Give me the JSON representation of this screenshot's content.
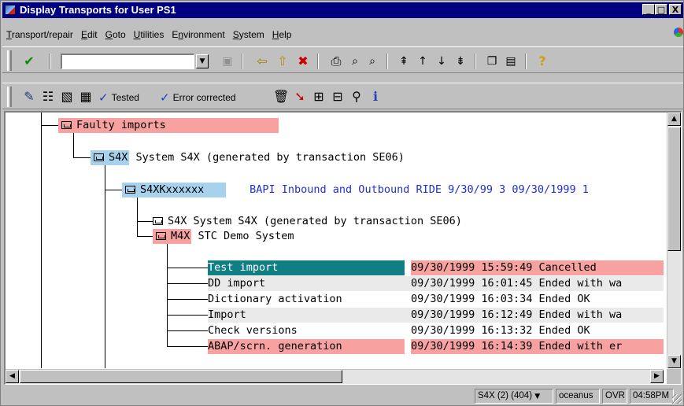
{
  "window": {
    "title": "Display Transports for User PS1",
    "minimize": "_",
    "restore": "□",
    "close": "X"
  },
  "menu": [
    {
      "pre": "",
      "u": "T",
      "post": "ransport/repair"
    },
    {
      "pre": "",
      "u": "E",
      "post": "dit"
    },
    {
      "pre": "",
      "u": "G",
      "post": "oto"
    },
    {
      "pre": "",
      "u": "U",
      "post": "tilities"
    },
    {
      "pre": "E",
      "u": "n",
      "post": "vironment"
    },
    {
      "pre": "",
      "u": "S",
      "post": "ystem"
    },
    {
      "pre": "",
      "u": "H",
      "post": "elp"
    }
  ],
  "toolbar1": {
    "command_value": "",
    "icons": [
      "checkmark-icon",
      "save-icon",
      "back-icon",
      "exit-icon",
      "cancel-icon",
      "print-icon",
      "find-icon",
      "find-next-icon",
      "first-page-icon",
      "previous-page-icon",
      "next-page-icon",
      "last-page-icon",
      "create-session-icon",
      "shortcut-icon",
      "help-icon"
    ]
  },
  "toolbar2": {
    "tested_label": "Tested",
    "error_corrected_label": "Error corrected"
  },
  "tree": {
    "faulty_imports": "Faulty imports",
    "system_node": {
      "key": "S4X",
      "text": "System S4X (generated by transaction SE06)"
    },
    "request_node": {
      "key": "S4XKxxxxxx",
      "desc": "BAPI Inbound and Outbound RIDE 9/30/99 3 09/30/1999 1"
    },
    "sub_system_node": {
      "key": "S4X",
      "text": "System S4X (generated by transaction SE06)"
    },
    "target_node": {
      "key": "M4X",
      "text": "STC Demo System"
    },
    "steps": [
      {
        "name": "Test import",
        "status": "09/30/1999 15:59:49 Cancelled"
      },
      {
        "name": "DD import",
        "status": "09/30/1999 16:01:45 Ended with wa"
      },
      {
        "name": "Dictionary activation",
        "status": "09/30/1999 16:03:34 Ended OK"
      },
      {
        "name": "Import",
        "status": "09/30/1999 16:12:49 Ended with wa"
      },
      {
        "name": "Check versions",
        "status": "09/30/1999 16:13:32 Ended OK"
      },
      {
        "name": "ABAP/scrn. generation",
        "status": "09/30/1999 16:14:39 Ended with er"
      }
    ]
  },
  "statusbar": {
    "session": "S4X (2) (404)",
    "session_arrow": "▼",
    "server": "oceanus",
    "mode": "OVR",
    "time": "04:58PM"
  },
  "colors": {
    "title_bg": "#000080",
    "error_highlight": "#f7a1a1",
    "system_highlight": "#a7d2ee",
    "selected_row": "#0f7f84",
    "description_text": "#1f2fd0"
  }
}
